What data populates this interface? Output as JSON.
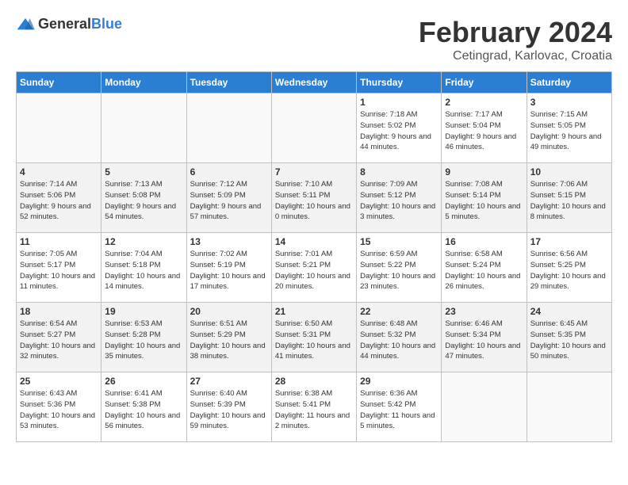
{
  "header": {
    "logo_general": "General",
    "logo_blue": "Blue",
    "title": "February 2024",
    "subtitle": "Cetingrad, Karlovac, Croatia"
  },
  "calendar": {
    "days_of_week": [
      "Sunday",
      "Monday",
      "Tuesday",
      "Wednesday",
      "Thursday",
      "Friday",
      "Saturday"
    ],
    "weeks": [
      [
        {
          "day": "",
          "info": ""
        },
        {
          "day": "",
          "info": ""
        },
        {
          "day": "",
          "info": ""
        },
        {
          "day": "",
          "info": ""
        },
        {
          "day": "1",
          "info": "Sunrise: 7:18 AM\nSunset: 5:02 PM\nDaylight: 9 hours\nand 44 minutes."
        },
        {
          "day": "2",
          "info": "Sunrise: 7:17 AM\nSunset: 5:04 PM\nDaylight: 9 hours\nand 46 minutes."
        },
        {
          "day": "3",
          "info": "Sunrise: 7:15 AM\nSunset: 5:05 PM\nDaylight: 9 hours\nand 49 minutes."
        }
      ],
      [
        {
          "day": "4",
          "info": "Sunrise: 7:14 AM\nSunset: 5:06 PM\nDaylight: 9 hours\nand 52 minutes."
        },
        {
          "day": "5",
          "info": "Sunrise: 7:13 AM\nSunset: 5:08 PM\nDaylight: 9 hours\nand 54 minutes."
        },
        {
          "day": "6",
          "info": "Sunrise: 7:12 AM\nSunset: 5:09 PM\nDaylight: 9 hours\nand 57 minutes."
        },
        {
          "day": "7",
          "info": "Sunrise: 7:10 AM\nSunset: 5:11 PM\nDaylight: 10 hours\nand 0 minutes."
        },
        {
          "day": "8",
          "info": "Sunrise: 7:09 AM\nSunset: 5:12 PM\nDaylight: 10 hours\nand 3 minutes."
        },
        {
          "day": "9",
          "info": "Sunrise: 7:08 AM\nSunset: 5:14 PM\nDaylight: 10 hours\nand 5 minutes."
        },
        {
          "day": "10",
          "info": "Sunrise: 7:06 AM\nSunset: 5:15 PM\nDaylight: 10 hours\nand 8 minutes."
        }
      ],
      [
        {
          "day": "11",
          "info": "Sunrise: 7:05 AM\nSunset: 5:17 PM\nDaylight: 10 hours\nand 11 minutes."
        },
        {
          "day": "12",
          "info": "Sunrise: 7:04 AM\nSunset: 5:18 PM\nDaylight: 10 hours\nand 14 minutes."
        },
        {
          "day": "13",
          "info": "Sunrise: 7:02 AM\nSunset: 5:19 PM\nDaylight: 10 hours\nand 17 minutes."
        },
        {
          "day": "14",
          "info": "Sunrise: 7:01 AM\nSunset: 5:21 PM\nDaylight: 10 hours\nand 20 minutes."
        },
        {
          "day": "15",
          "info": "Sunrise: 6:59 AM\nSunset: 5:22 PM\nDaylight: 10 hours\nand 23 minutes."
        },
        {
          "day": "16",
          "info": "Sunrise: 6:58 AM\nSunset: 5:24 PM\nDaylight: 10 hours\nand 26 minutes."
        },
        {
          "day": "17",
          "info": "Sunrise: 6:56 AM\nSunset: 5:25 PM\nDaylight: 10 hours\nand 29 minutes."
        }
      ],
      [
        {
          "day": "18",
          "info": "Sunrise: 6:54 AM\nSunset: 5:27 PM\nDaylight: 10 hours\nand 32 minutes."
        },
        {
          "day": "19",
          "info": "Sunrise: 6:53 AM\nSunset: 5:28 PM\nDaylight: 10 hours\nand 35 minutes."
        },
        {
          "day": "20",
          "info": "Sunrise: 6:51 AM\nSunset: 5:29 PM\nDaylight: 10 hours\nand 38 minutes."
        },
        {
          "day": "21",
          "info": "Sunrise: 6:50 AM\nSunset: 5:31 PM\nDaylight: 10 hours\nand 41 minutes."
        },
        {
          "day": "22",
          "info": "Sunrise: 6:48 AM\nSunset: 5:32 PM\nDaylight: 10 hours\nand 44 minutes."
        },
        {
          "day": "23",
          "info": "Sunrise: 6:46 AM\nSunset: 5:34 PM\nDaylight: 10 hours\nand 47 minutes."
        },
        {
          "day": "24",
          "info": "Sunrise: 6:45 AM\nSunset: 5:35 PM\nDaylight: 10 hours\nand 50 minutes."
        }
      ],
      [
        {
          "day": "25",
          "info": "Sunrise: 6:43 AM\nSunset: 5:36 PM\nDaylight: 10 hours\nand 53 minutes."
        },
        {
          "day": "26",
          "info": "Sunrise: 6:41 AM\nSunset: 5:38 PM\nDaylight: 10 hours\nand 56 minutes."
        },
        {
          "day": "27",
          "info": "Sunrise: 6:40 AM\nSunset: 5:39 PM\nDaylight: 10 hours\nand 59 minutes."
        },
        {
          "day": "28",
          "info": "Sunrise: 6:38 AM\nSunset: 5:41 PM\nDaylight: 11 hours\nand 2 minutes."
        },
        {
          "day": "29",
          "info": "Sunrise: 6:36 AM\nSunset: 5:42 PM\nDaylight: 11 hours\nand 5 minutes."
        },
        {
          "day": "",
          "info": ""
        },
        {
          "day": "",
          "info": ""
        }
      ]
    ]
  }
}
